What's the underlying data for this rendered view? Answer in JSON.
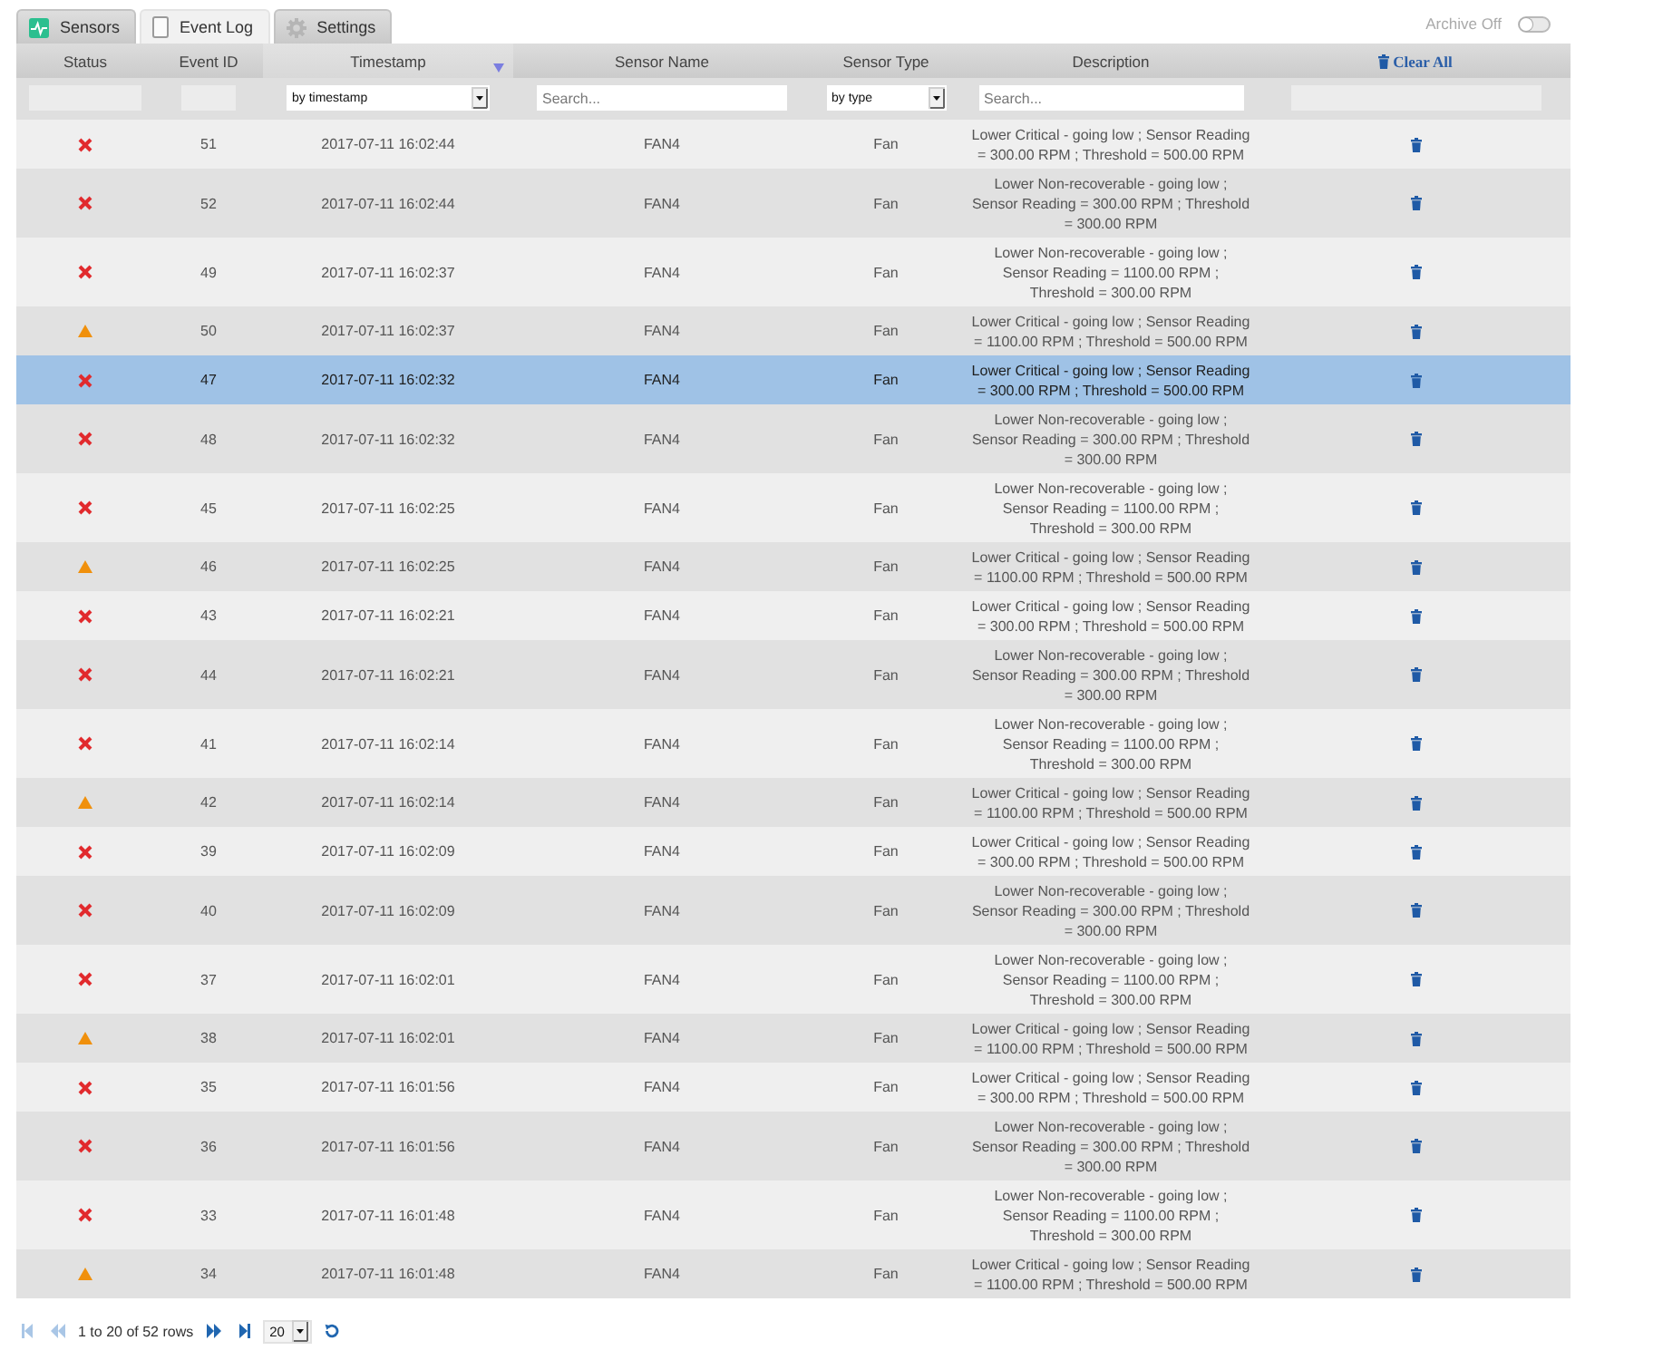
{
  "tabs": [
    {
      "label": "Sensors",
      "selected": false
    },
    {
      "label": "Event Log",
      "selected": true
    },
    {
      "label": "Settings",
      "selected": false
    }
  ],
  "archive": {
    "label": "Archive Off",
    "on": false
  },
  "table": {
    "columns": [
      {
        "kind": "label",
        "label": "Status",
        "sorted": false
      },
      {
        "kind": "label",
        "label": "Event ID",
        "sorted": false
      },
      {
        "kind": "label",
        "label": "Timestamp",
        "sorted": true
      },
      {
        "kind": "label",
        "label": "Sensor Name",
        "sorted": false
      },
      {
        "kind": "label",
        "label": "Sensor Type",
        "sorted": false
      },
      {
        "kind": "label",
        "label": "Description",
        "sorted": false
      },
      {
        "kind": "action",
        "label": "Clear All",
        "sorted": false
      }
    ],
    "filters": [
      {
        "kind": "blank",
        "disabled": true
      },
      {
        "kind": "blank",
        "disabled": true
      },
      {
        "kind": "select",
        "value": "by timestamp"
      },
      {
        "kind": "search",
        "placeholder": "Search..."
      },
      {
        "kind": "select",
        "value": "by type"
      },
      {
        "kind": "search",
        "placeholder": "Search..."
      },
      {
        "kind": "blank",
        "disabled": true
      }
    ],
    "rows": [
      {
        "kind": "critical",
        "event_id": "51",
        "timestamp": "2017-07-11 16:02:44",
        "sensor_name": "FAN4",
        "sensor_type": "Fan",
        "description": "Lower Critical - going low ; Sensor Reading = 300.00 RPM ; Threshold = 500.00 RPM",
        "selected": false
      },
      {
        "kind": "critical",
        "event_id": "52",
        "timestamp": "2017-07-11 16:02:44",
        "sensor_name": "FAN4",
        "sensor_type": "Fan",
        "description": "Lower Non-recoverable - going low ; Sensor Reading = 300.00 RPM ; Threshold = 300.00 RPM",
        "selected": false
      },
      {
        "kind": "critical",
        "event_id": "49",
        "timestamp": "2017-07-11 16:02:37",
        "sensor_name": "FAN4",
        "sensor_type": "Fan",
        "description": "Lower Non-recoverable - going low ; Sensor Reading = 1100.00 RPM ; Threshold = 300.00 RPM",
        "selected": false
      },
      {
        "kind": "warning",
        "event_id": "50",
        "timestamp": "2017-07-11 16:02:37",
        "sensor_name": "FAN4",
        "sensor_type": "Fan",
        "description": "Lower Critical - going low ; Sensor Reading = 1100.00 RPM ; Threshold = 500.00 RPM",
        "selected": false
      },
      {
        "kind": "critical",
        "event_id": "47",
        "timestamp": "2017-07-11 16:02:32",
        "sensor_name": "FAN4",
        "sensor_type": "Fan",
        "description": "Lower Critical - going low ; Sensor Reading = 300.00 RPM ; Threshold = 500.00 RPM",
        "selected": true
      },
      {
        "kind": "critical",
        "event_id": "48",
        "timestamp": "2017-07-11 16:02:32",
        "sensor_name": "FAN4",
        "sensor_type": "Fan",
        "description": "Lower Non-recoverable - going low ; Sensor Reading = 300.00 RPM ; Threshold = 300.00 RPM",
        "selected": false
      },
      {
        "kind": "critical",
        "event_id": "45",
        "timestamp": "2017-07-11 16:02:25",
        "sensor_name": "FAN4",
        "sensor_type": "Fan",
        "description": "Lower Non-recoverable - going low ; Sensor Reading = 1100.00 RPM ; Threshold = 300.00 RPM",
        "selected": false
      },
      {
        "kind": "warning",
        "event_id": "46",
        "timestamp": "2017-07-11 16:02:25",
        "sensor_name": "FAN4",
        "sensor_type": "Fan",
        "description": "Lower Critical - going low ; Sensor Reading = 1100.00 RPM ; Threshold = 500.00 RPM",
        "selected": false
      },
      {
        "kind": "critical",
        "event_id": "43",
        "timestamp": "2017-07-11 16:02:21",
        "sensor_name": "FAN4",
        "sensor_type": "Fan",
        "description": "Lower Critical - going low ; Sensor Reading = 300.00 RPM ; Threshold = 500.00 RPM",
        "selected": false
      },
      {
        "kind": "critical",
        "event_id": "44",
        "timestamp": "2017-07-11 16:02:21",
        "sensor_name": "FAN4",
        "sensor_type": "Fan",
        "description": "Lower Non-recoverable - going low ; Sensor Reading = 300.00 RPM ; Threshold = 300.00 RPM",
        "selected": false
      },
      {
        "kind": "critical",
        "event_id": "41",
        "timestamp": "2017-07-11 16:02:14",
        "sensor_name": "FAN4",
        "sensor_type": "Fan",
        "description": "Lower Non-recoverable - going low ; Sensor Reading = 1100.00 RPM ; Threshold = 300.00 RPM",
        "selected": false
      },
      {
        "kind": "warning",
        "event_id": "42",
        "timestamp": "2017-07-11 16:02:14",
        "sensor_name": "FAN4",
        "sensor_type": "Fan",
        "description": "Lower Critical - going low ; Sensor Reading = 1100.00 RPM ; Threshold = 500.00 RPM",
        "selected": false
      },
      {
        "kind": "critical",
        "event_id": "39",
        "timestamp": "2017-07-11 16:02:09",
        "sensor_name": "FAN4",
        "sensor_type": "Fan",
        "description": "Lower Critical - going low ; Sensor Reading = 300.00 RPM ; Threshold = 500.00 RPM",
        "selected": false
      },
      {
        "kind": "critical",
        "event_id": "40",
        "timestamp": "2017-07-11 16:02:09",
        "sensor_name": "FAN4",
        "sensor_type": "Fan",
        "description": "Lower Non-recoverable - going low ; Sensor Reading = 300.00 RPM ; Threshold = 300.00 RPM",
        "selected": false
      },
      {
        "kind": "critical",
        "event_id": "37",
        "timestamp": "2017-07-11 16:02:01",
        "sensor_name": "FAN4",
        "sensor_type": "Fan",
        "description": "Lower Non-recoverable - going low ; Sensor Reading = 1100.00 RPM ; Threshold = 300.00 RPM",
        "selected": false
      },
      {
        "kind": "warning",
        "event_id": "38",
        "timestamp": "2017-07-11 16:02:01",
        "sensor_name": "FAN4",
        "sensor_type": "Fan",
        "description": "Lower Critical - going low ; Sensor Reading = 1100.00 RPM ; Threshold = 500.00 RPM",
        "selected": false
      },
      {
        "kind": "critical",
        "event_id": "35",
        "timestamp": "2017-07-11 16:01:56",
        "sensor_name": "FAN4",
        "sensor_type": "Fan",
        "description": "Lower Critical - going low ; Sensor Reading = 300.00 RPM ; Threshold = 500.00 RPM",
        "selected": false
      },
      {
        "kind": "critical",
        "event_id": "36",
        "timestamp": "2017-07-11 16:01:56",
        "sensor_name": "FAN4",
        "sensor_type": "Fan",
        "description": "Lower Non-recoverable - going low ; Sensor Reading = 300.00 RPM ; Threshold = 300.00 RPM",
        "selected": false
      },
      {
        "kind": "critical",
        "event_id": "33",
        "timestamp": "2017-07-11 16:01:48",
        "sensor_name": "FAN4",
        "sensor_type": "Fan",
        "description": "Lower Non-recoverable - going low ; Sensor Reading = 1100.00 RPM ; Threshold = 300.00 RPM",
        "selected": false
      },
      {
        "kind": "warning",
        "event_id": "34",
        "timestamp": "2017-07-11 16:01:48",
        "sensor_name": "FAN4",
        "sensor_type": "Fan",
        "description": "Lower Critical - going low ; Sensor Reading = 1100.00 RPM ; Threshold = 500.00 RPM",
        "selected": false
      }
    ]
  },
  "pagination": {
    "controls_before": [
      {
        "kind": "first",
        "disabled": true
      },
      {
        "kind": "previous",
        "disabled": true
      }
    ],
    "summary": "1 to 20 of 52 rows",
    "controls_after": [
      {
        "kind": "next",
        "disabled": false
      },
      {
        "kind": "last",
        "disabled": false
      }
    ],
    "page_size": "20"
  }
}
